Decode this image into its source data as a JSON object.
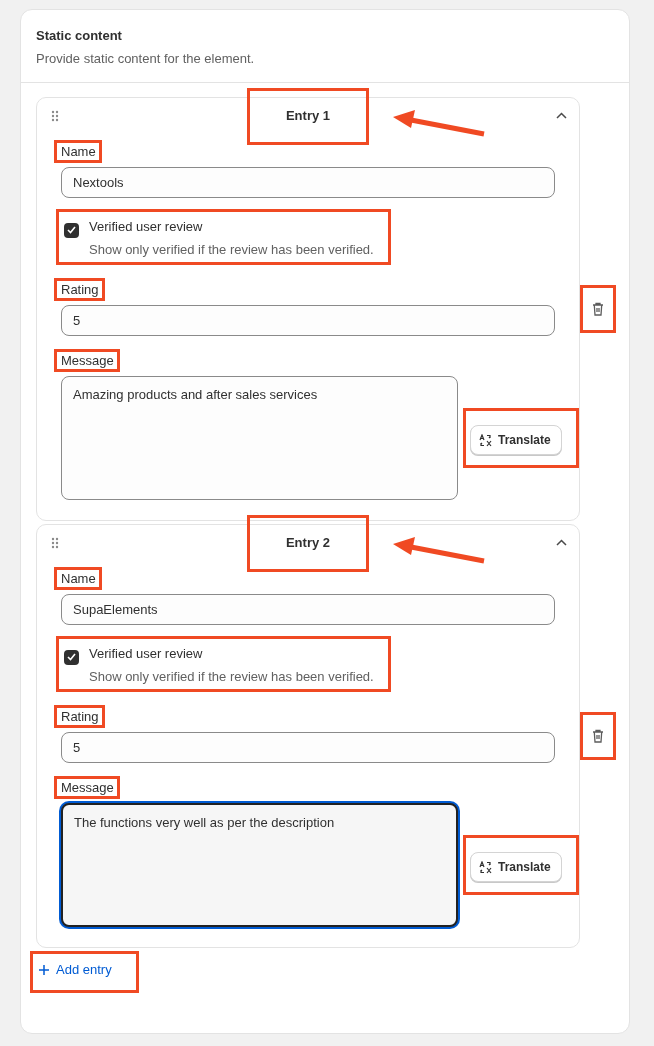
{
  "annotations": {
    "highlight_boxes": true,
    "arrows": true
  },
  "section": {
    "title": "Static content",
    "description": "Provide static content for the element."
  },
  "entries": [
    {
      "title": "Entry 1",
      "expanded": true,
      "name": {
        "label": "Name",
        "value": "Nextools"
      },
      "verified": {
        "label": "Verified user review",
        "help": "Show only verified if the review has been verified.",
        "checked": true
      },
      "rating": {
        "label": "Rating",
        "value": "5"
      },
      "message": {
        "label": "Message",
        "value": "Amazing products and after sales services",
        "focused": false
      },
      "translate": "Translate"
    },
    {
      "title": "Entry 2",
      "expanded": true,
      "name": {
        "label": "Name",
        "value": "SupaElements"
      },
      "verified": {
        "label": "Verified user review",
        "help": "Show only verified if the review has been verified.",
        "checked": true
      },
      "rating": {
        "label": "Rating",
        "value": "5"
      },
      "message": {
        "label": "Message",
        "value": "The functions very well as per the description",
        "focused": true
      },
      "translate": "Translate"
    }
  ],
  "add_entry": "Add entry"
}
